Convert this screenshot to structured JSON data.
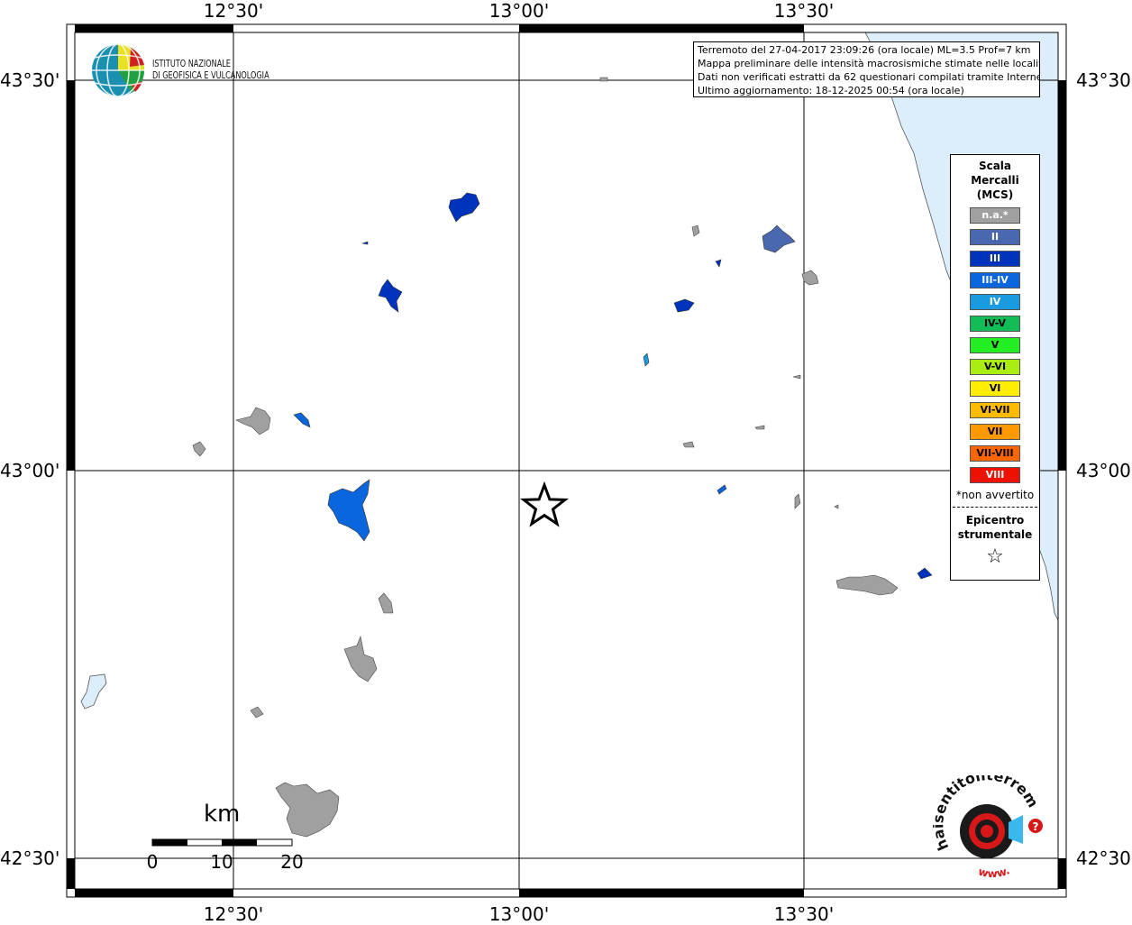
{
  "map": {
    "lon_labels": [
      "12°30'",
      "13°00'",
      "13°30'"
    ],
    "lat_labels": [
      "43°30'",
      "43°00'",
      "42°30'"
    ],
    "epicenter_symbol": "star"
  },
  "info_box": {
    "line1": "Terremoto del 27-04-2017 23:09:26 (ora locale) ML=3.5 Prof=7 km",
    "line2": "Mappa preliminare delle intensità macrosismiche stimate nelle località",
    "line3": "Dati non verificati estratti da 62 questionari compilati tramite Internet.",
    "line4": "Ultimo aggiornamento: 18-12-2025 00:54 (ora locale)"
  },
  "legend": {
    "title_lines": [
      "Scala",
      "Mercalli",
      "(MCS)"
    ],
    "classes": [
      {
        "label": "n.a.*",
        "color": "#a0a0a0",
        "text_color": "#ffffff"
      },
      {
        "label": "II",
        "color": "#4a68b0",
        "text_color": "#ffffff"
      },
      {
        "label": "III",
        "color": "#0033bb",
        "text_color": "#ffffff"
      },
      {
        "label": "III-IV",
        "color": "#0a66dd",
        "text_color": "#ffffff"
      },
      {
        "label": "IV",
        "color": "#1a9ae0",
        "text_color": "#ffffff"
      },
      {
        "label": "IV-V",
        "color": "#11bb55",
        "text_color": "#000000"
      },
      {
        "label": "V",
        "color": "#22ee22",
        "text_color": "#000000"
      },
      {
        "label": "V-VI",
        "color": "#aaee11",
        "text_color": "#000000"
      },
      {
        "label": "VI",
        "color": "#ffee00",
        "text_color": "#000000"
      },
      {
        "label": "VI-VII",
        "color": "#ffbb00",
        "text_color": "#000000"
      },
      {
        "label": "VII",
        "color": "#ff9900",
        "text_color": "#000000"
      },
      {
        "label": "VII-VIII",
        "color": "#ff6600",
        "text_color": "#000000"
      },
      {
        "label": "VIII",
        "color": "#ee1100",
        "text_color": "#ffffff"
      }
    ],
    "na_note": "*non avvertito",
    "epicenter_lines": [
      "Epicentro",
      "strumentale"
    ],
    "epicenter_icon": "star-outline-icon"
  },
  "ingv_logo": {
    "line1": "ISTITUTO NAZIONALE",
    "line2": "DI GEOFISICA E VULCANOLOGIA"
  },
  "scale_bar": {
    "unit": "km",
    "ticks": [
      "0",
      "10",
      "20"
    ]
  },
  "hsit_logo": {
    "text": "haisentitoilterremoto.it",
    "url_text": "www.",
    "question": "?"
  },
  "colors": {
    "sea": "#dbeefa",
    "grid": "#000000",
    "na": "#a0a0a0",
    "ii": "#4a68b0",
    "iii": "#0033bb",
    "iii_iv": "#0a66dd",
    "iv": "#1a9ae0"
  }
}
